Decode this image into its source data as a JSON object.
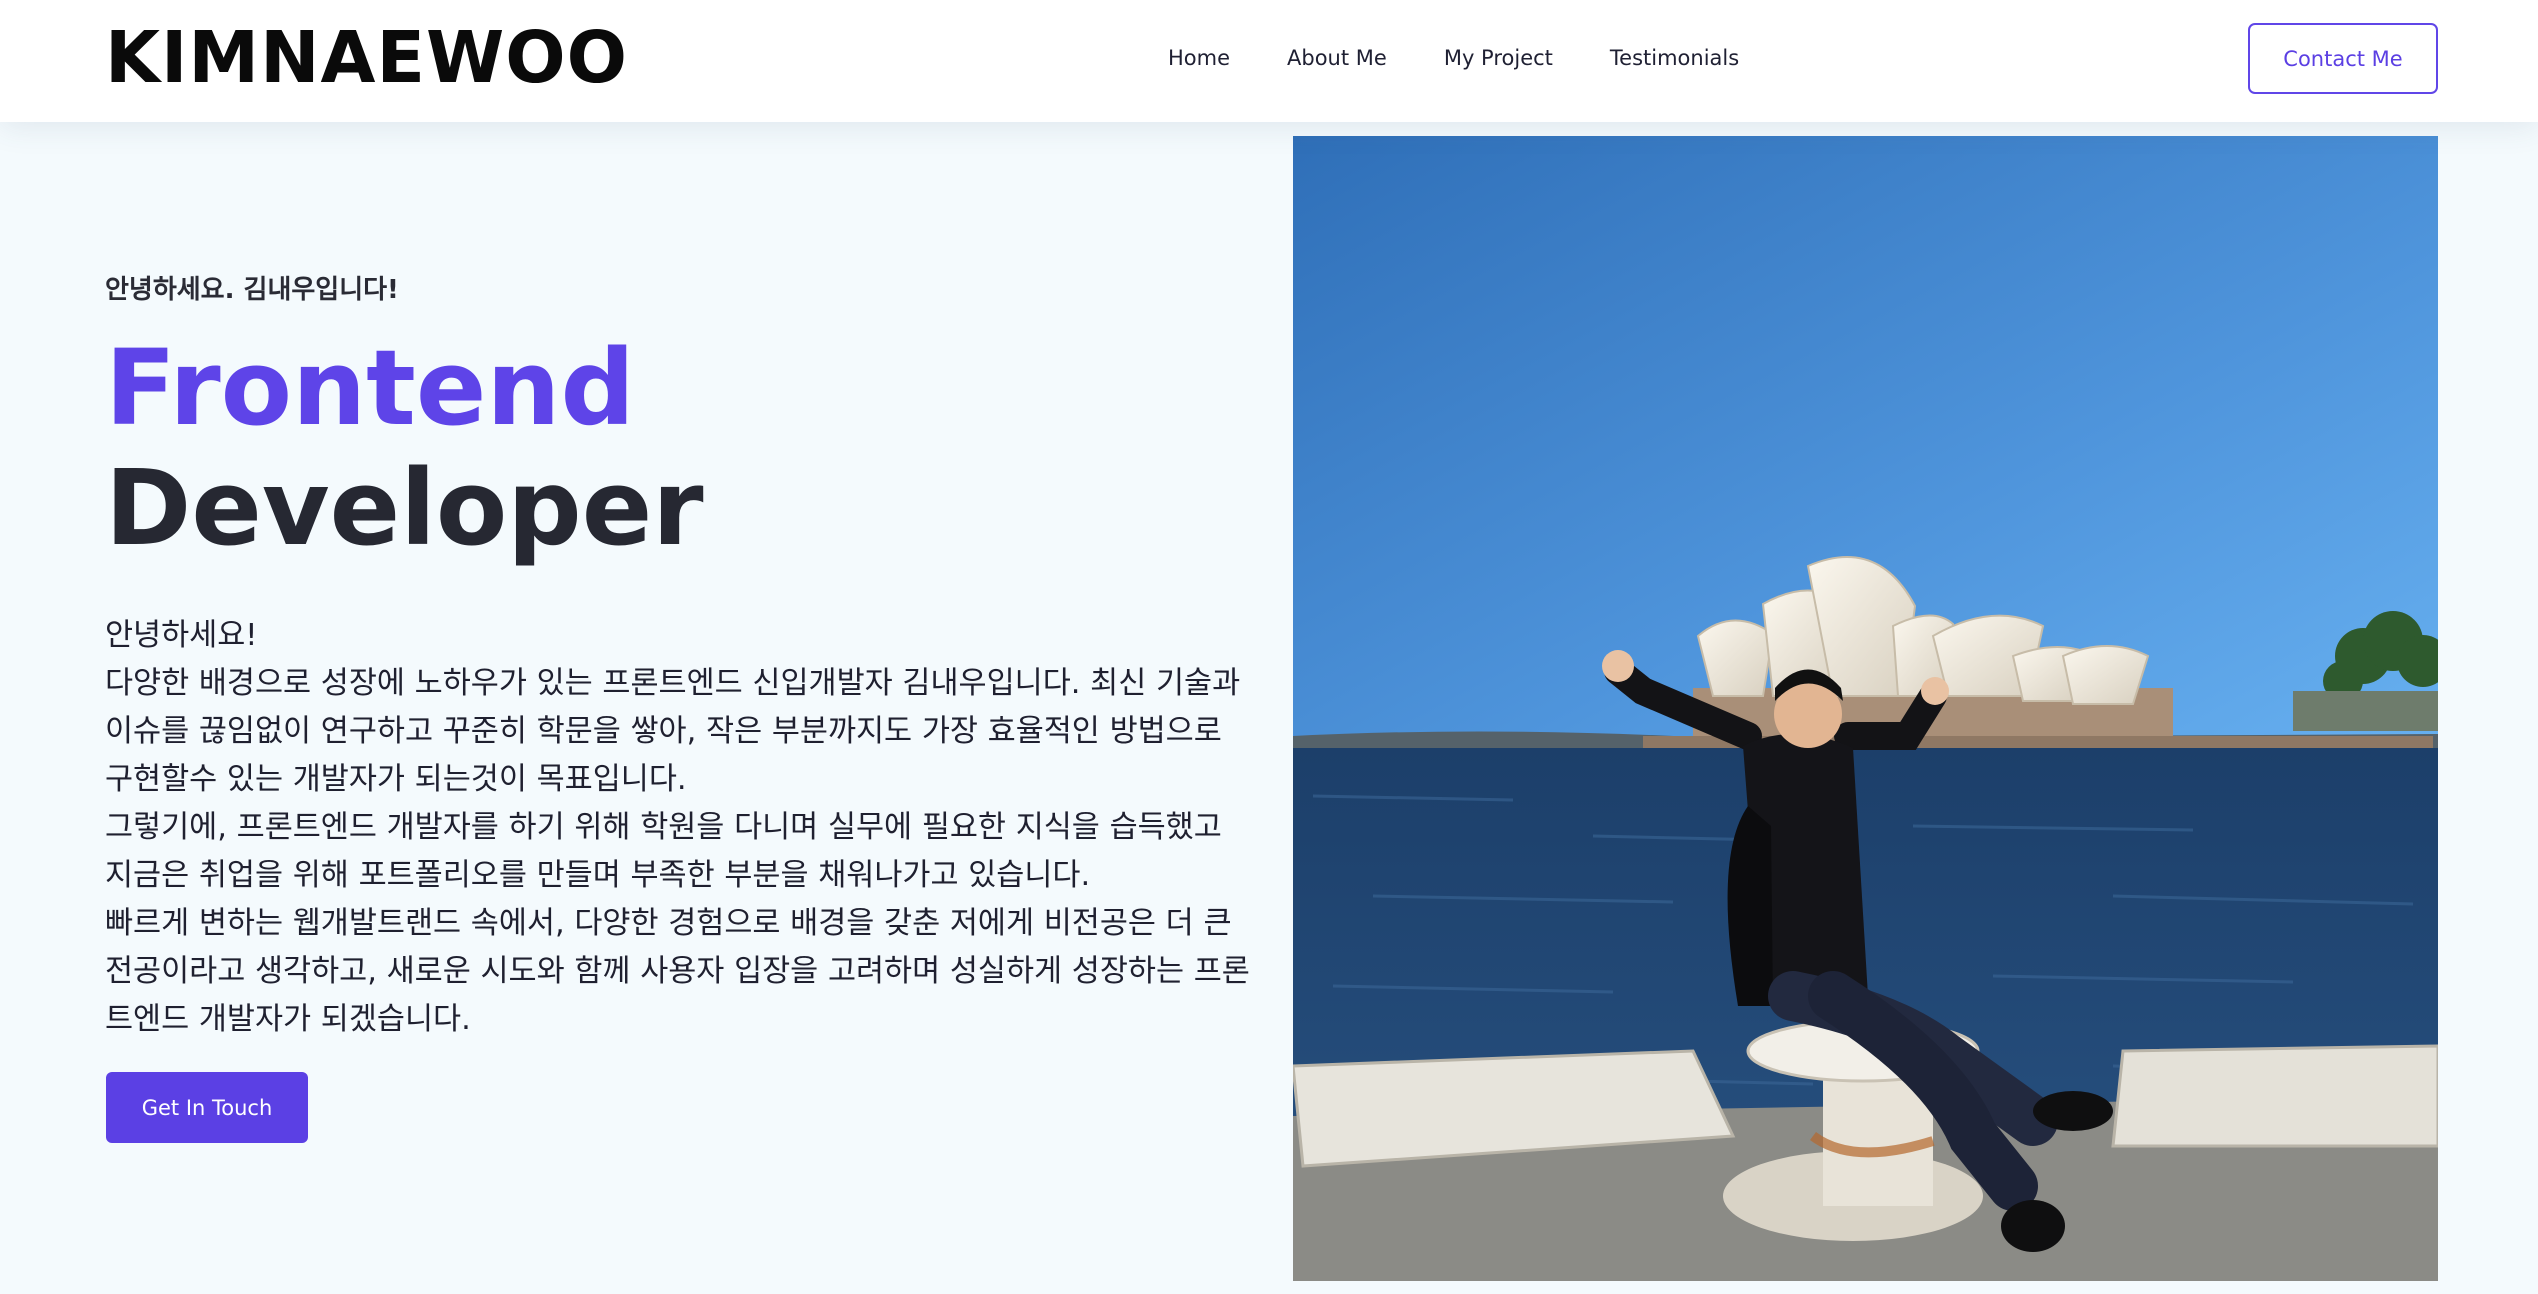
{
  "header": {
    "logo": "KIMNAEWOO",
    "nav": [
      "Home",
      "About Me",
      "My Project",
      "Testimonials"
    ],
    "contact_label": "Contact Me"
  },
  "hero": {
    "greeting": "안녕하세요. 김내우입니다!",
    "title_accent": "Frontend",
    "title_main": "Developer",
    "description": [
      "안녕하세요!",
      "다양한 배경으로 성장에 노하우가 있는 프론트엔드 신입개발자 김내우입니다. 최신 기술과 이슈를 끊임없이 연구하고 꾸준히 학문을 쌓아, 작은 부분까지도 가장 효율적인 방법으로 구현할수 있는 개발자가 되는것이 목표입니다.",
      "그렇기에, 프론트엔드 개발자를 하기 위해 학원을 다니며 실무에 필요한 지식을 습득했고 지금은 취업을 위해 포트폴리오를 만들며 부족한 부분을 채워나가고 있습니다.",
      "빠르게 변하는 웹개발트랜드 속에서, 다양한 경험으로 배경을 갖춘 저에게 비전공은 더 큰 전공이라고 생각하고, 새로운 시도와 함께 사용자 입장을 고려하며 성실하게 성장하는 프론트엔드 개발자가 되겠습니다."
    ],
    "cta_label": "Get In Touch"
  },
  "colors": {
    "accent": "#5e44e8",
    "page_background": "#f4fafd",
    "heading": "#262832"
  }
}
